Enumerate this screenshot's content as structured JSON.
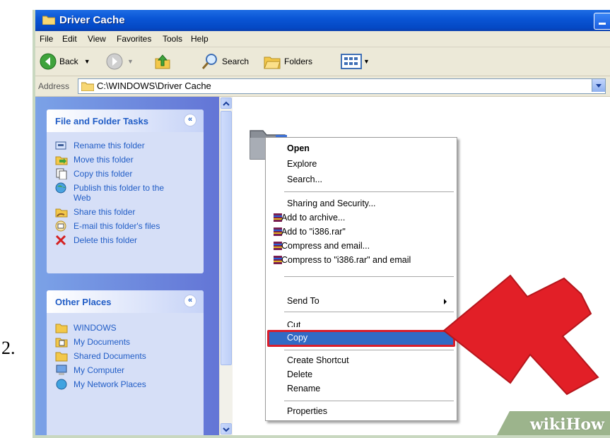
{
  "step_number": "2.",
  "window": {
    "title": "Driver Cache"
  },
  "menu": [
    "File",
    "Edit",
    "View",
    "Favorites",
    "Tools",
    "Help"
  ],
  "toolbar": {
    "back": "Back",
    "search": "Search",
    "folders": "Folders"
  },
  "address": {
    "label": "Address",
    "value": "C:\\WINDOWS\\Driver Cache"
  },
  "sidebar": {
    "file_folder_tasks": {
      "title": "File and Folder Tasks",
      "items": [
        "Rename this folder",
        "Move this folder",
        "Copy this folder",
        "Publish this folder to the Web",
        "Share this folder",
        "E-mail this folder's files",
        "Delete this folder"
      ]
    },
    "other_places": {
      "title": "Other Places",
      "items": [
        "WINDOWS",
        "My Documents",
        "Shared Documents",
        "My Computer",
        "My Network Places"
      ]
    }
  },
  "context_menu": {
    "open": "Open",
    "explore": "Explore",
    "search": "Search...",
    "sharing": "Sharing and Security...",
    "add_archive": "Add to archive...",
    "add_rar": "Add to \"i386.rar\"",
    "compress_email": "Compress and email...",
    "compress_rar_email": "Compress to \"i386.rar\" and email",
    "send_to": "Send To",
    "cut": "Cut",
    "copy": "Copy",
    "create_shortcut": "Create Shortcut",
    "delete": "Delete",
    "rename": "Rename",
    "properties": "Properties"
  },
  "watermark": {
    "text": "wikiHow"
  },
  "colors": {
    "titlebar": "#0a56d6",
    "highlight": "#316ac5",
    "arrow": "#e0202c",
    "sidebar": "#7ba2e7"
  }
}
